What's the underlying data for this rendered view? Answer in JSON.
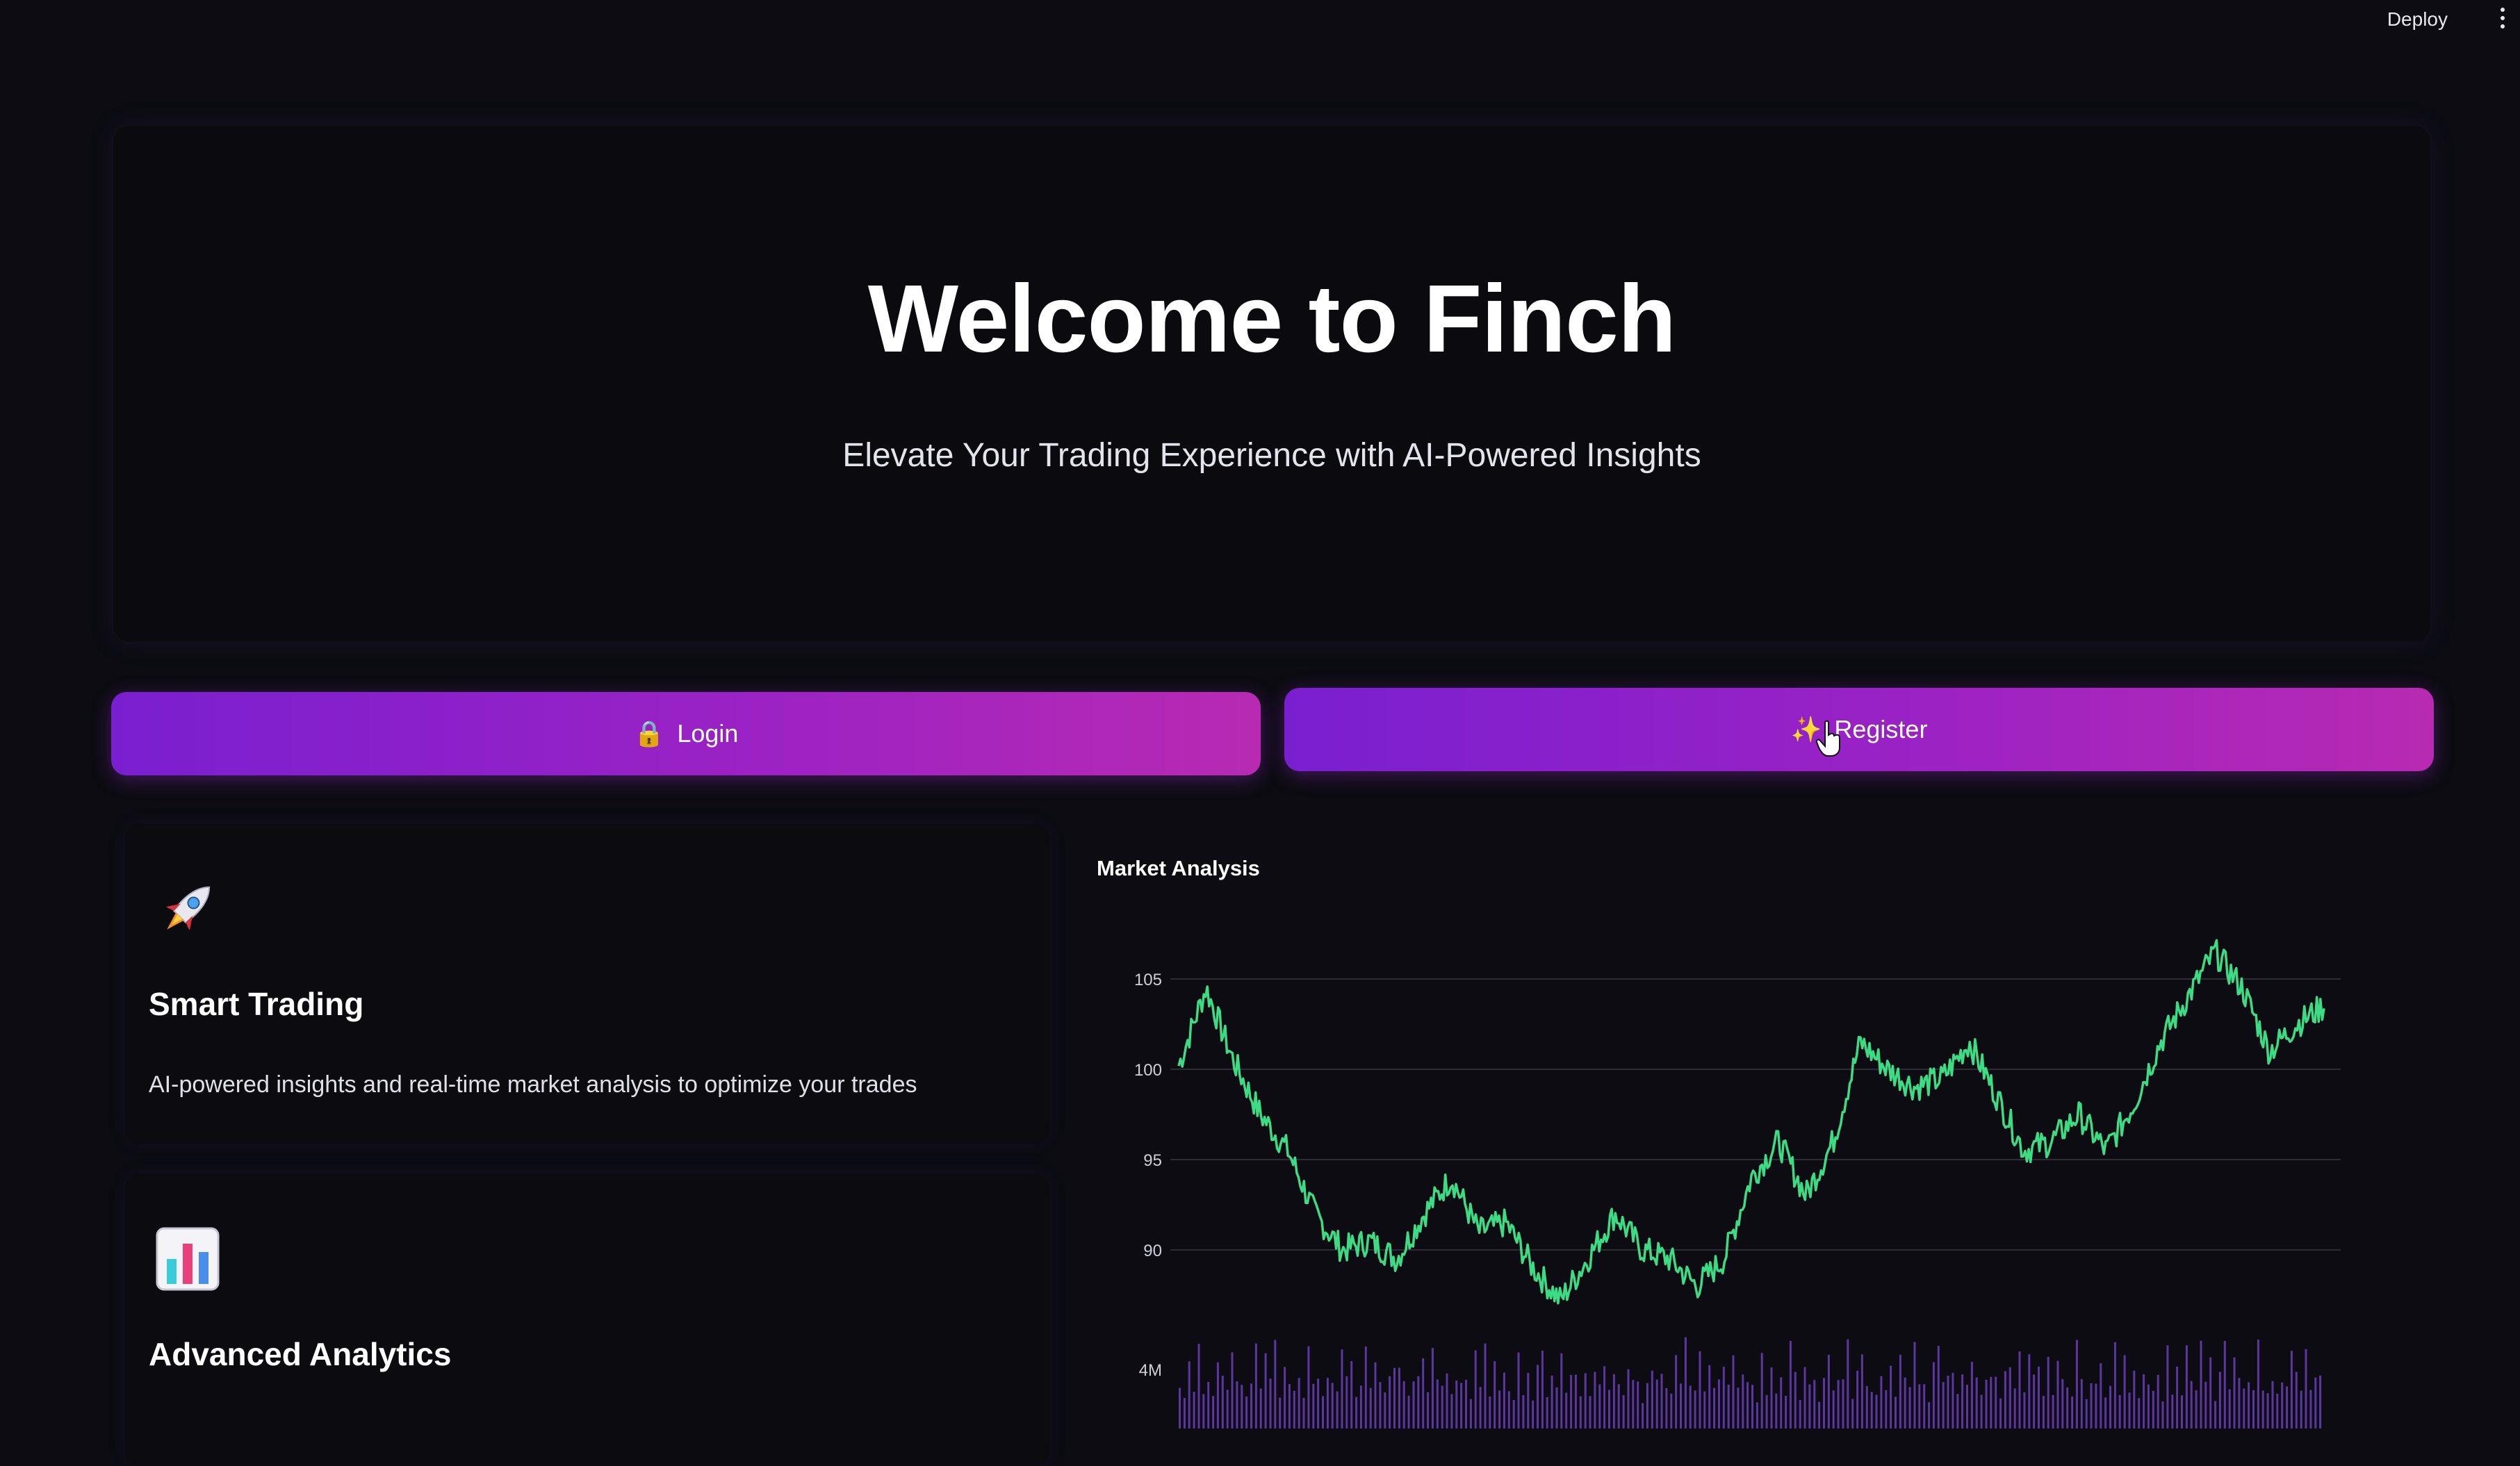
{
  "topbar": {
    "deploy_label": "Deploy"
  },
  "hero": {
    "title": "Welcome to Finch",
    "subtitle": "Elevate Your Trading Experience with AI-Powered Insights"
  },
  "buttons": {
    "login": {
      "icon": "🔒",
      "label": "Login"
    },
    "register": {
      "icon": "✨",
      "label": "Register"
    }
  },
  "features": [
    {
      "icon": "rocket-icon",
      "title": "Smart Trading",
      "description": "AI-powered insights and real-time market analysis to optimize your trades"
    },
    {
      "icon": "bar-chart-icon",
      "title": "Advanced Analytics",
      "description": ""
    }
  ],
  "colors": {
    "accent_start": "#7a1fd0",
    "accent_end": "#b82ab2",
    "line": "#3ddc84",
    "volume": "#6a3fb8"
  },
  "chart_data": {
    "type": "line",
    "title": "Market Analysis",
    "ylim": [
      86.5,
      106.5
    ],
    "yticks": [
      105,
      100,
      95,
      90
    ],
    "grid": true,
    "price_series": {
      "x": [
        0,
        4,
        8,
        12,
        16,
        20,
        24,
        28,
        32,
        36,
        40,
        44,
        48,
        52,
        56,
        60,
        64,
        68,
        72,
        76,
        80,
        84,
        88,
        92,
        96,
        100,
        104,
        108,
        112,
        116,
        120,
        124,
        128,
        132,
        136,
        140,
        144,
        148,
        152,
        156,
        160,
        164,
        168,
        172,
        176,
        180,
        184,
        188,
        192,
        196,
        200
      ],
      "values": [
        100.2,
        104.5,
        100.5,
        97.5,
        95.5,
        92.0,
        90.0,
        90.5,
        89.5,
        92.0,
        94.0,
        91.0,
        91.5,
        89.0,
        87.2,
        89.5,
        92.0,
        90.0,
        89.5,
        88.0,
        89.5,
        94.0,
        96.0,
        93.0,
        96.0,
        101.5,
        100.0,
        99.0,
        99.5,
        101.5,
        98.5,
        95.5,
        96.0,
        97.5,
        95.5,
        98.0,
        101.5,
        104.0,
        106.5,
        104.5,
        101.0,
        102.5,
        103.5
      ]
    },
    "volume_series": {
      "tick_label": "4M",
      "values": [
        0.6,
        0.2,
        0.8,
        0.35,
        0.9,
        0.4,
        0.7,
        0.25,
        0.95,
        0.5,
        0.3,
        0.85,
        0.45,
        0.7,
        0.2,
        0.6,
        0.9,
        0.35,
        0.75,
        0.5,
        0.95,
        0.3,
        0.65,
        0.8,
        0.4,
        0.55,
        0.25,
        0.9,
        0.45,
        0.7,
        0.35,
        0.85,
        0.6,
        0.3,
        0.95,
        0.5,
        0.75,
        0.2,
        0.65,
        0.9,
        0.4,
        0.7,
        0.55,
        0.3,
        0.85,
        0.6,
        0.95,
        0.45,
        0.25,
        0.8,
        0.5,
        0.7,
        0.35,
        0.9,
        0.6,
        0.4,
        0.85,
        0.3,
        0.75,
        0.5
      ]
    }
  }
}
